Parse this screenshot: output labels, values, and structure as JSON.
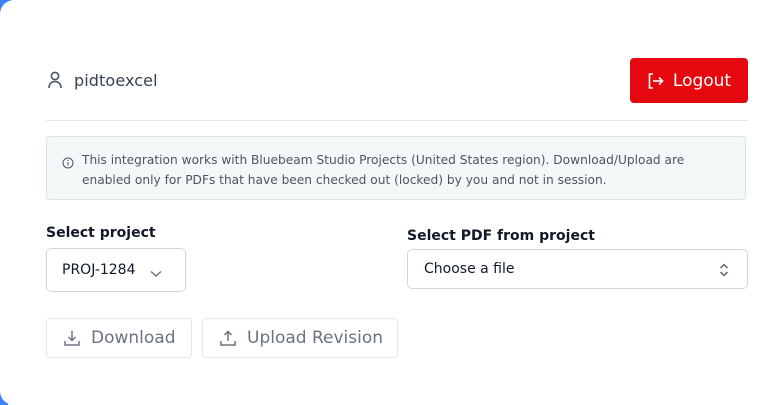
{
  "header": {
    "username": "pidtoexcel",
    "logout_label": "Logout"
  },
  "notice": {
    "line1": "This integration works with Bluebeam Studio Projects (United States region). Download/Upload are",
    "line2": "enabled only for PDFs that have been checked out (locked) by you and not in session."
  },
  "project_select": {
    "label": "Select project",
    "selected": "PROJ-1284"
  },
  "pdf_select": {
    "label": "Select PDF from project",
    "selected": "Choose a file"
  },
  "actions": {
    "download_label": "Download",
    "upload_label": "Upload Revision"
  },
  "colors": {
    "accent_frame": "#3b82f6",
    "logout_bg": "#e5090f"
  },
  "icons": {
    "user": "user-icon",
    "logout": "logout-icon",
    "info": "info-icon",
    "chevron": "chevron-down-icon",
    "updown": "updown-chevron-icon",
    "download": "download-icon",
    "upload": "upload-icon"
  }
}
